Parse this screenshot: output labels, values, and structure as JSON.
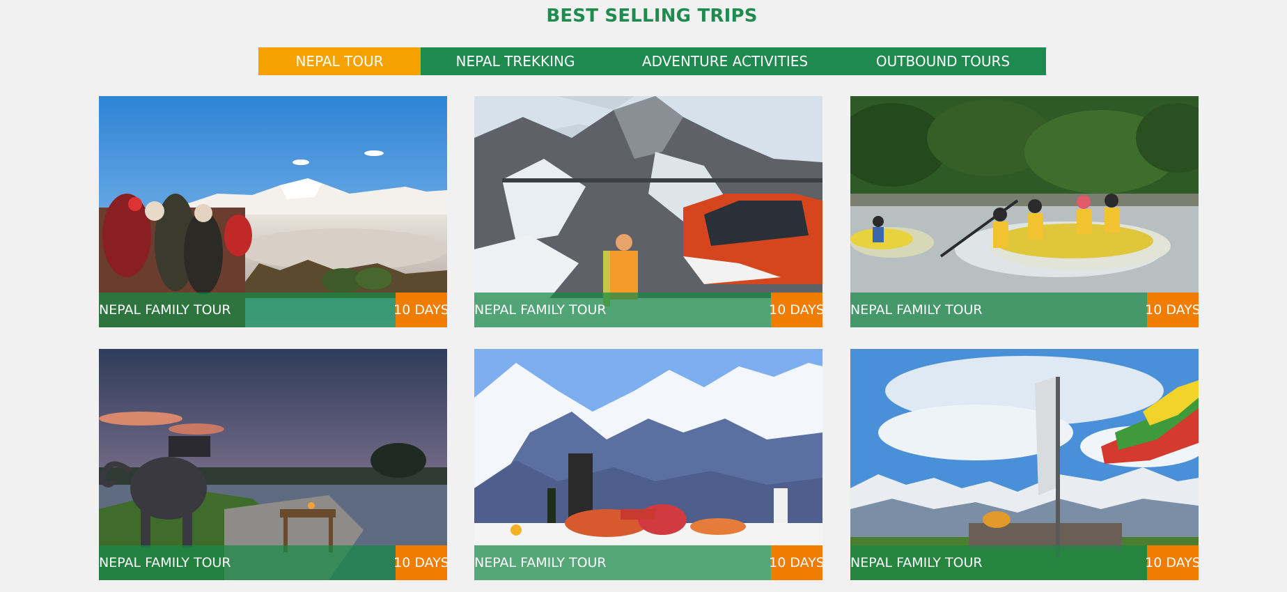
{
  "section": {
    "title": "BEST SELLING TRIPS"
  },
  "tabs": [
    {
      "label": "NEPAL TOUR",
      "active": true
    },
    {
      "label": "NEPAL TREKKING",
      "active": false
    },
    {
      "label": "ADVENTURE ACTIVITIES",
      "active": false
    },
    {
      "label": "OUTBOUND TOURS",
      "active": false
    }
  ],
  "colors": {
    "brand_green": "#208b4f",
    "active_tab": "#f5a200",
    "days_badge": "#f07c00",
    "page_bg": "#f1f1f1"
  },
  "trips": [
    {
      "name": "NEPAL FAMILY TOUR",
      "duration": "10 DAYS",
      "photo": "sunrise-mountain-viewpoint"
    },
    {
      "name": "NEPAL FAMILY TOUR",
      "duration": "10 DAYS",
      "photo": "helicopter-snow-mountain"
    },
    {
      "name": "NEPAL FAMILY TOUR",
      "duration": "10 DAYS",
      "photo": "river-rafting"
    },
    {
      "name": "NEPAL FAMILY TOUR",
      "duration": "10 DAYS",
      "photo": "elephant-lakeside-dinner"
    },
    {
      "name": "NEPAL FAMILY TOUR",
      "duration": "10 DAYS",
      "photo": "mountain-picnic-table"
    },
    {
      "name": "NEPAL FAMILY TOUR",
      "duration": "10 DAYS",
      "photo": "prayer-flags-himalaya"
    }
  ]
}
